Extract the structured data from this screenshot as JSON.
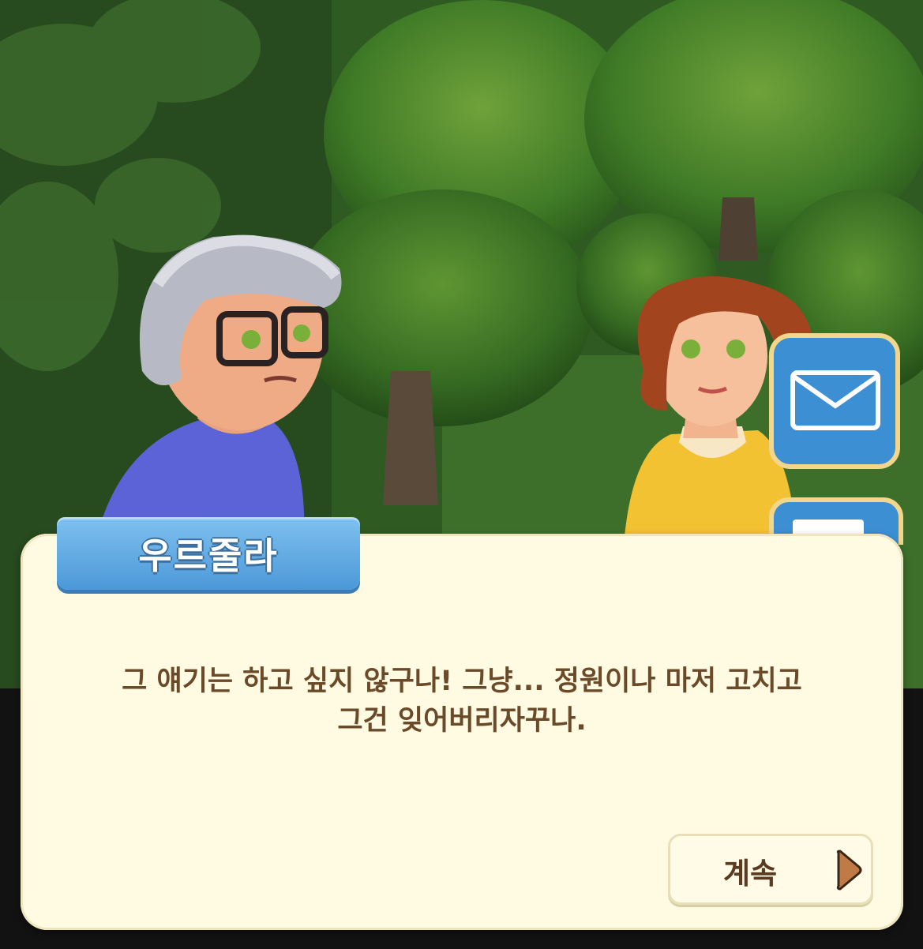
{
  "speaker": {
    "name": "우르줄라"
  },
  "dialog": {
    "line1": "그 얘기는 하고 싶지 않구나! 그냥... 정원이나 마저 고치고",
    "line2": "그건 잊어버리자꾸나."
  },
  "continue_button": {
    "label": "계속",
    "icon": "play-arrow-icon"
  },
  "side_buttons": [
    {
      "icon": "mail-icon"
    },
    {
      "icon": "card-icon"
    }
  ],
  "characters": [
    {
      "role": "speaker",
      "hair": "gray",
      "outfit": "blue"
    },
    {
      "role": "listener",
      "hair": "auburn",
      "outfit": "yellow"
    }
  ],
  "colors": {
    "dialog_bg": "#fffbe2",
    "dialog_text": "#6b4a2a",
    "name_tag": "#5aa6e3",
    "button_bg": "#fffbe6",
    "arrow": "#c07a45"
  }
}
